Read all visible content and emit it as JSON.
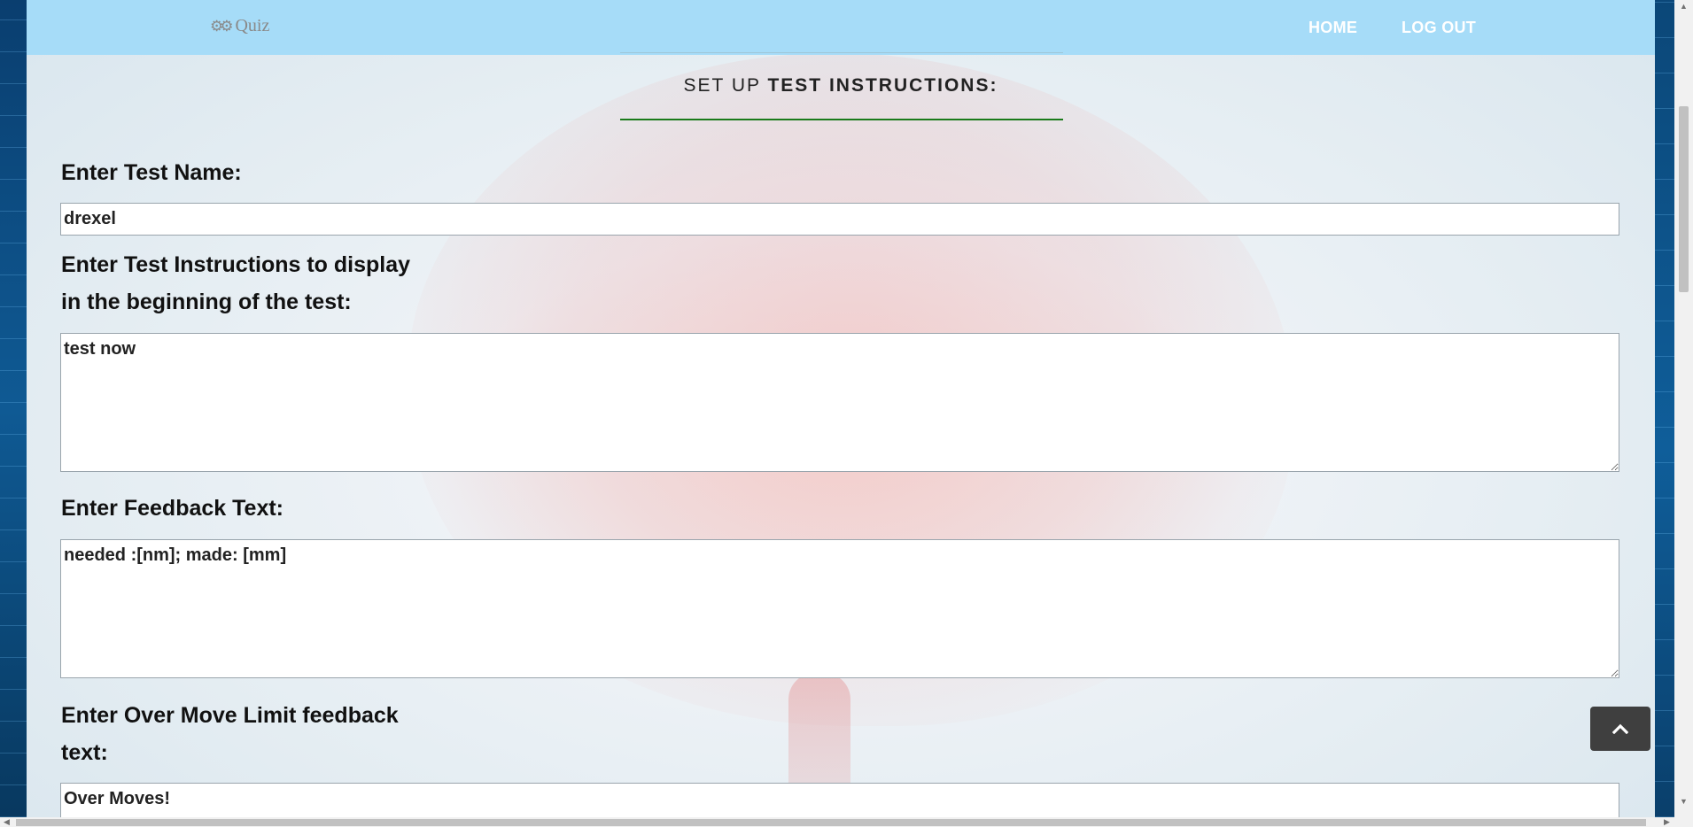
{
  "nav": {
    "brand": "Quiz",
    "brand_icon": "gears-icon",
    "home_label": "HOME",
    "logout_label": "LOG OUT"
  },
  "page": {
    "heading_prefix": "SET UP ",
    "heading_bold": "TEST INSTRUCTIONS:"
  },
  "form": {
    "test_name_label": "Enter Test Name:",
    "test_name_value": "drexel",
    "instructions_label_line1": "Enter Test Instructions to display",
    "instructions_label_line2": "in the beginning of the test:",
    "instructions_value": "test now",
    "feedback_label": "Enter Feedback Text:",
    "feedback_value": "needed :[nm]; made: [mm]",
    "over_move_label_line1": "Enter Over Move Limit feedback",
    "over_move_label_line2": "text:",
    "over_move_value": "Over Moves!"
  },
  "colors": {
    "navbar": "#a6dcf8",
    "heading_rule": "#1a7a1a",
    "to_top_button": "#3f3f3f"
  }
}
